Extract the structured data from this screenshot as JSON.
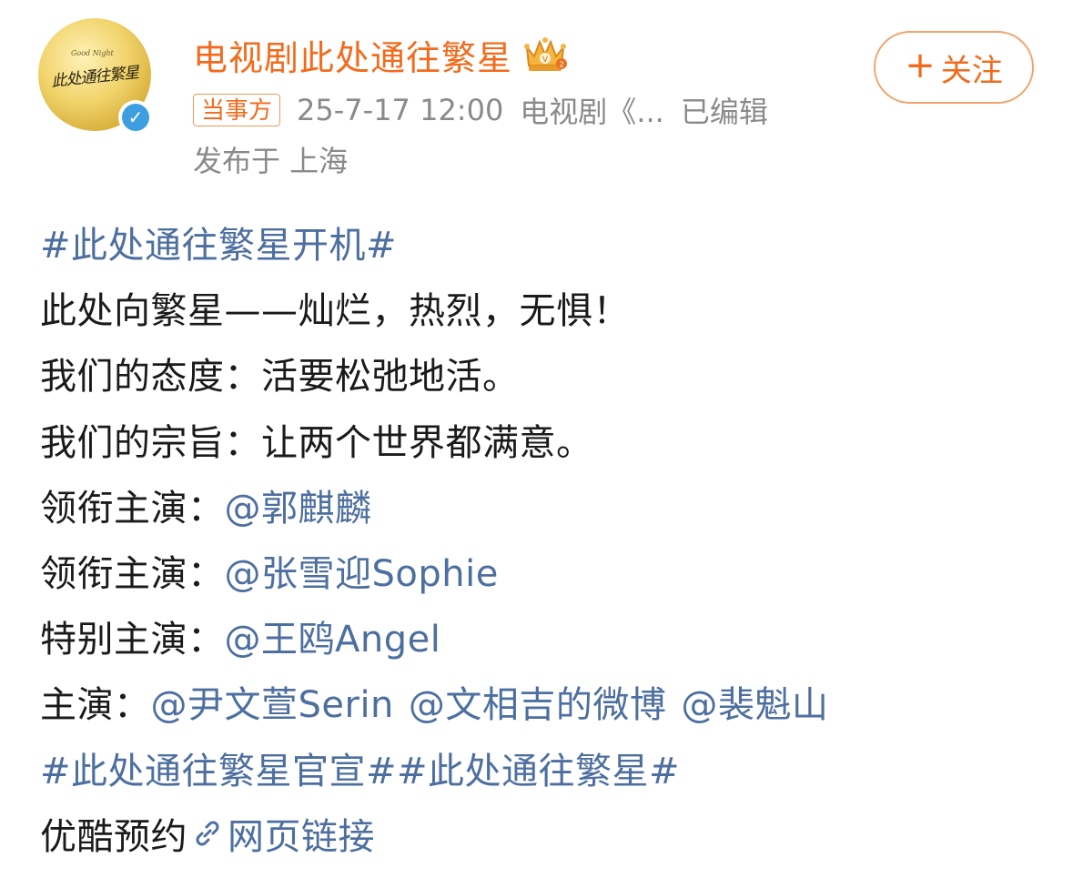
{
  "header": {
    "username": "电视剧此处通往繁星",
    "avatar_text": "此处通往繁星",
    "avatar_subtext": "Good Night",
    "follow_label": "关注",
    "party_badge": "当事方",
    "timestamp": "25-7-17 12:00",
    "source": "电视剧《...",
    "edited": "已编辑",
    "location": "发布于 上海",
    "accent_color": "#f26b1d"
  },
  "post": {
    "hashtag_top": "#此处通往繁星开机#",
    "line1": "此处向繁星——灿烂，热烈，无惧！",
    "line2": "我们的态度：活要松弛地活。",
    "line3": "我们的宗旨：让两个世界都满意。",
    "lead1_label": "领衔主演：",
    "lead1_mention": "@郭麒麟",
    "lead2_label": "领衔主演：",
    "lead2_mention": "@张雪迎Sophie",
    "special_label": "特别主演：",
    "special_mention": "@王鸥Angel",
    "cast_label": "主演：",
    "cast_mentions": [
      "@尹文萱Serin",
      "@文相吉的微博",
      "@裴魁山"
    ],
    "hashtags_bottom": "#此处通往繁星官宣##此处通往繁星#",
    "reserve_label": "优酷预约",
    "web_link_label": "网页链接",
    "link_color": "#4d6fa0"
  }
}
